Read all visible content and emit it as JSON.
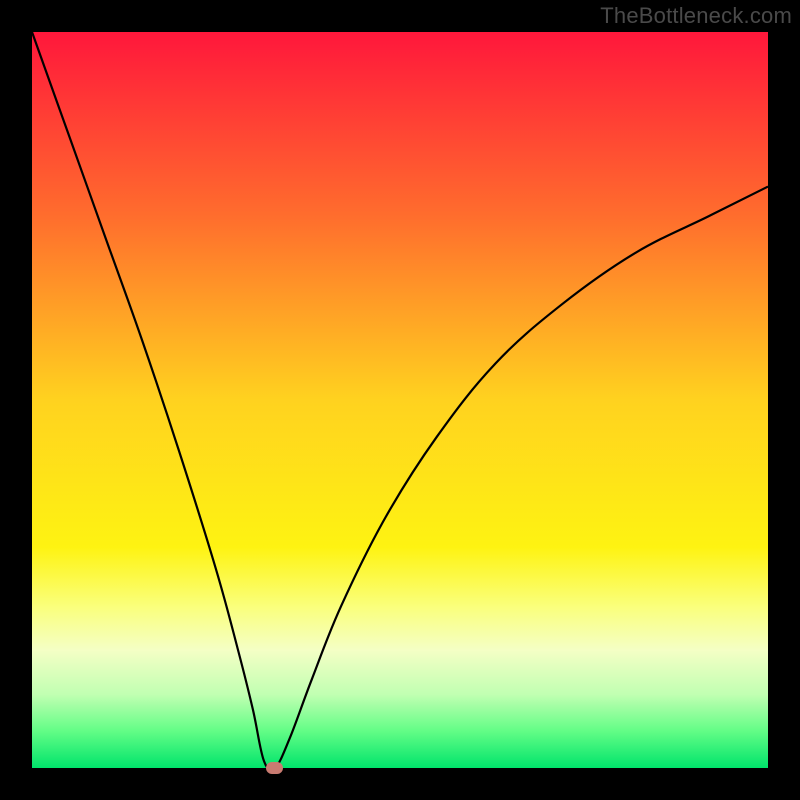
{
  "watermark": "TheBottleneck.com",
  "chart_data": {
    "type": "line",
    "title": "",
    "xlabel": "",
    "ylabel": "",
    "xlim": [
      0,
      100
    ],
    "ylim": [
      0,
      100
    ],
    "background_gradient_stops": [
      {
        "pct": 0,
        "color": "#ff173b"
      },
      {
        "pct": 25,
        "color": "#ff6d2d"
      },
      {
        "pct": 50,
        "color": "#ffd21f"
      },
      {
        "pct": 70,
        "color": "#fef312"
      },
      {
        "pct": 78,
        "color": "#faff7b"
      },
      {
        "pct": 84,
        "color": "#f4ffc5"
      },
      {
        "pct": 90,
        "color": "#c1ffb2"
      },
      {
        "pct": 95,
        "color": "#62fd86"
      },
      {
        "pct": 100,
        "color": "#00e46b"
      }
    ],
    "series": [
      {
        "name": "bottleneck-curve",
        "x": [
          0,
          5,
          10,
          15,
          20,
          25,
          28,
          30,
          31.5,
          33,
          35,
          38,
          42,
          48,
          55,
          63,
          72,
          82,
          92,
          100
        ],
        "y": [
          100,
          86,
          72,
          58,
          43,
          27,
          16,
          8,
          1,
          0,
          4,
          12,
          22,
          34,
          45,
          55,
          63,
          70,
          75,
          79
        ]
      }
    ],
    "marker": {
      "x": 33,
      "y": 0,
      "label": "optimal-point"
    }
  }
}
